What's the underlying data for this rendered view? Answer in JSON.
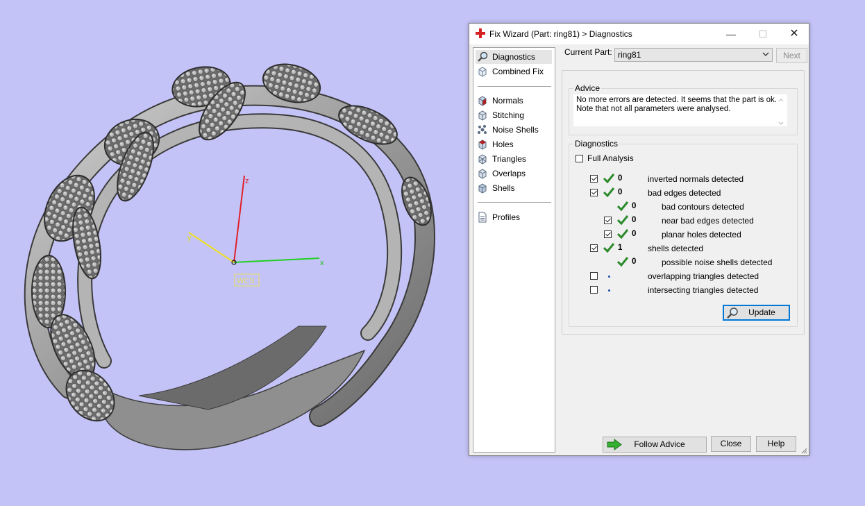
{
  "window": {
    "title": "Fix Wizard (Part: ring81) > Diagnostics",
    "minimize_glyph": "—",
    "maximize_glyph": "☐",
    "close_glyph": "✕"
  },
  "viewport": {
    "axes": {
      "z_label": "z",
      "y_label": "y",
      "x_label": "x",
      "origin_label": "WCS"
    },
    "colors": {
      "background": "#c4c3f7",
      "z_axis": "#e0202a",
      "y_axis": "#f0e020",
      "x_axis": "#20d020",
      "wcs_box": "#e8e060"
    }
  },
  "nav": {
    "items_top": [
      {
        "label": "Diagnostics",
        "icon": "magnifier-icon",
        "selected": true
      },
      {
        "label": "Combined Fix",
        "icon": "cube-icon"
      }
    ],
    "items_mid": [
      {
        "label": "Normals",
        "icon": "normals-cube-icon"
      },
      {
        "label": "Stitching",
        "icon": "stitching-cube-icon"
      },
      {
        "label": "Noise Shells",
        "icon": "noise-shells-icon"
      },
      {
        "label": "Holes",
        "icon": "holes-cube-icon"
      },
      {
        "label": "Triangles",
        "icon": "triangles-cube-icon"
      },
      {
        "label": "Overlaps",
        "icon": "overlaps-cube-icon"
      },
      {
        "label": "Shells",
        "icon": "shells-cube-icon"
      }
    ],
    "items_bottom": [
      {
        "label": "Profiles",
        "icon": "document-icon"
      }
    ]
  },
  "current_part": {
    "label": "Current Part:",
    "value": "ring81",
    "next_label": "Next"
  },
  "advice": {
    "title": "Advice",
    "line1": "No more errors are detected. It seems that the part is ok.",
    "line2": "Note that not all parameters were analysed."
  },
  "diagnostics": {
    "title": "Diagnostics",
    "full_analysis_label": "Full Analysis",
    "full_analysis_checked": false,
    "rows": [
      {
        "checkbox": true,
        "checked": true,
        "status": "ok",
        "count": "0",
        "label": "inverted normals detected",
        "indent": 0
      },
      {
        "checkbox": true,
        "checked": true,
        "status": "ok",
        "count": "0",
        "label": "bad edges detected",
        "indent": 0
      },
      {
        "checkbox": false,
        "checked": false,
        "status": "ok",
        "count": "0",
        "label": "bad contours detected",
        "indent": 1
      },
      {
        "checkbox": true,
        "checked": true,
        "status": "ok",
        "count": "0",
        "label": "near bad edges detected",
        "indent": 1
      },
      {
        "checkbox": true,
        "checked": true,
        "status": "ok",
        "count": "0",
        "label": "planar holes detected",
        "indent": 1
      },
      {
        "checkbox": true,
        "checked": true,
        "status": "ok",
        "count": "1",
        "label": "shells detected",
        "indent": 0
      },
      {
        "checkbox": false,
        "checked": false,
        "status": "ok",
        "count": "0",
        "label": "possible noise shells detected",
        "indent": 1
      },
      {
        "checkbox": true,
        "checked": false,
        "status": "not-run",
        "count": "",
        "label": "overlapping triangles detected",
        "indent": 0
      },
      {
        "checkbox": true,
        "checked": false,
        "status": "not-run",
        "count": "",
        "label": "intersecting triangles detected",
        "indent": 0
      }
    ],
    "update_label": "Update"
  },
  "footer": {
    "follow_advice_label": "Follow Advice",
    "close_label": "Close",
    "help_label": "Help"
  },
  "colors": {
    "tick_green": "#2c8a2c",
    "accent_blue": "#0078d7",
    "title_icon_red": "#d42020"
  }
}
